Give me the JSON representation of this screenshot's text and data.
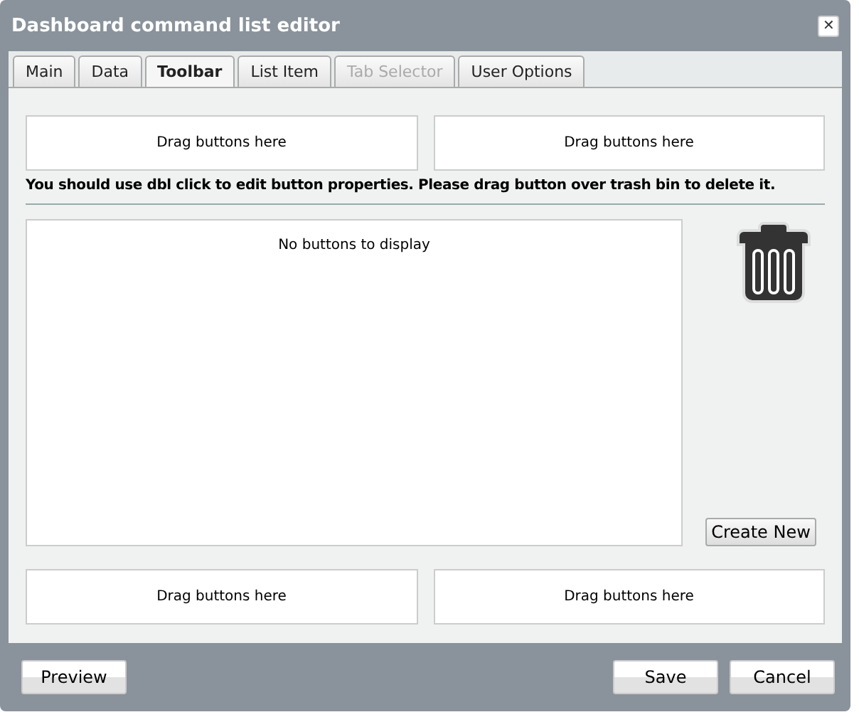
{
  "window": {
    "title": "Dashboard command list editor",
    "close": "✕"
  },
  "tabs": [
    {
      "label": "Main",
      "selected": false,
      "disabled": false
    },
    {
      "label": "Data",
      "selected": false,
      "disabled": false
    },
    {
      "label": "Toolbar",
      "selected": true,
      "disabled": false
    },
    {
      "label": "List Item",
      "selected": false,
      "disabled": false
    },
    {
      "label": "Tab Selector",
      "selected": false,
      "disabled": true
    },
    {
      "label": "User Options",
      "selected": false,
      "disabled": false
    }
  ],
  "top_zones": [
    "Drag buttons here",
    "Drag buttons here"
  ],
  "hint": "You should use dbl click to edit button properties. Please drag button over trash bin to delete it.",
  "buttons_list": {
    "empty_text": "No buttons to display"
  },
  "create_button": "Create New",
  "bottom_zones": [
    "Drag buttons here",
    "Drag buttons here"
  ],
  "footer": {
    "left": "Preview",
    "right": [
      "Save",
      "Cancel"
    ]
  }
}
